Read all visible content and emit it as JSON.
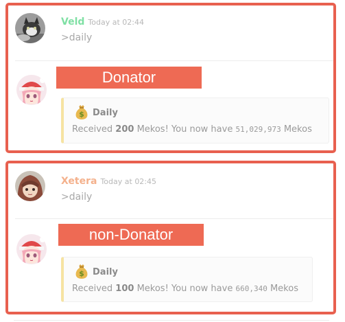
{
  "messages": [
    {
      "user": {
        "name": "Veld",
        "timestamp": "Today at 02:44",
        "avatar": "cat-avatar",
        "name_color": "#7fe0a4"
      },
      "command": ">daily",
      "banner": "Donator",
      "bot_avatar": "anime-girl-santa-avatar",
      "embed": {
        "icon": "money-bag-icon",
        "title": "Daily",
        "received_label": "Received",
        "amount": "200",
        "mid_text": "Mekos! You now have",
        "balance": "51,029,973",
        "currency": "Mekos"
      }
    },
    {
      "user": {
        "name": "Xetera",
        "timestamp": "Today at 02:45",
        "avatar": "hooded-character-avatar",
        "name_color": "#f4b18c"
      },
      "command": ">daily",
      "banner": "non-Donator",
      "bot_avatar": "anime-girl-santa-avatar",
      "embed": {
        "icon": "money-bag-icon",
        "title": "Daily",
        "received_label": "Received",
        "amount": "100",
        "mid_text": "Mekos! You now have",
        "balance": "660,340",
        "currency": "Mekos"
      }
    }
  ],
  "colors": {
    "highlight_border": "#e8604f",
    "banner_bg": "#ee6a54",
    "embed_accent": "#f6e3a2"
  }
}
